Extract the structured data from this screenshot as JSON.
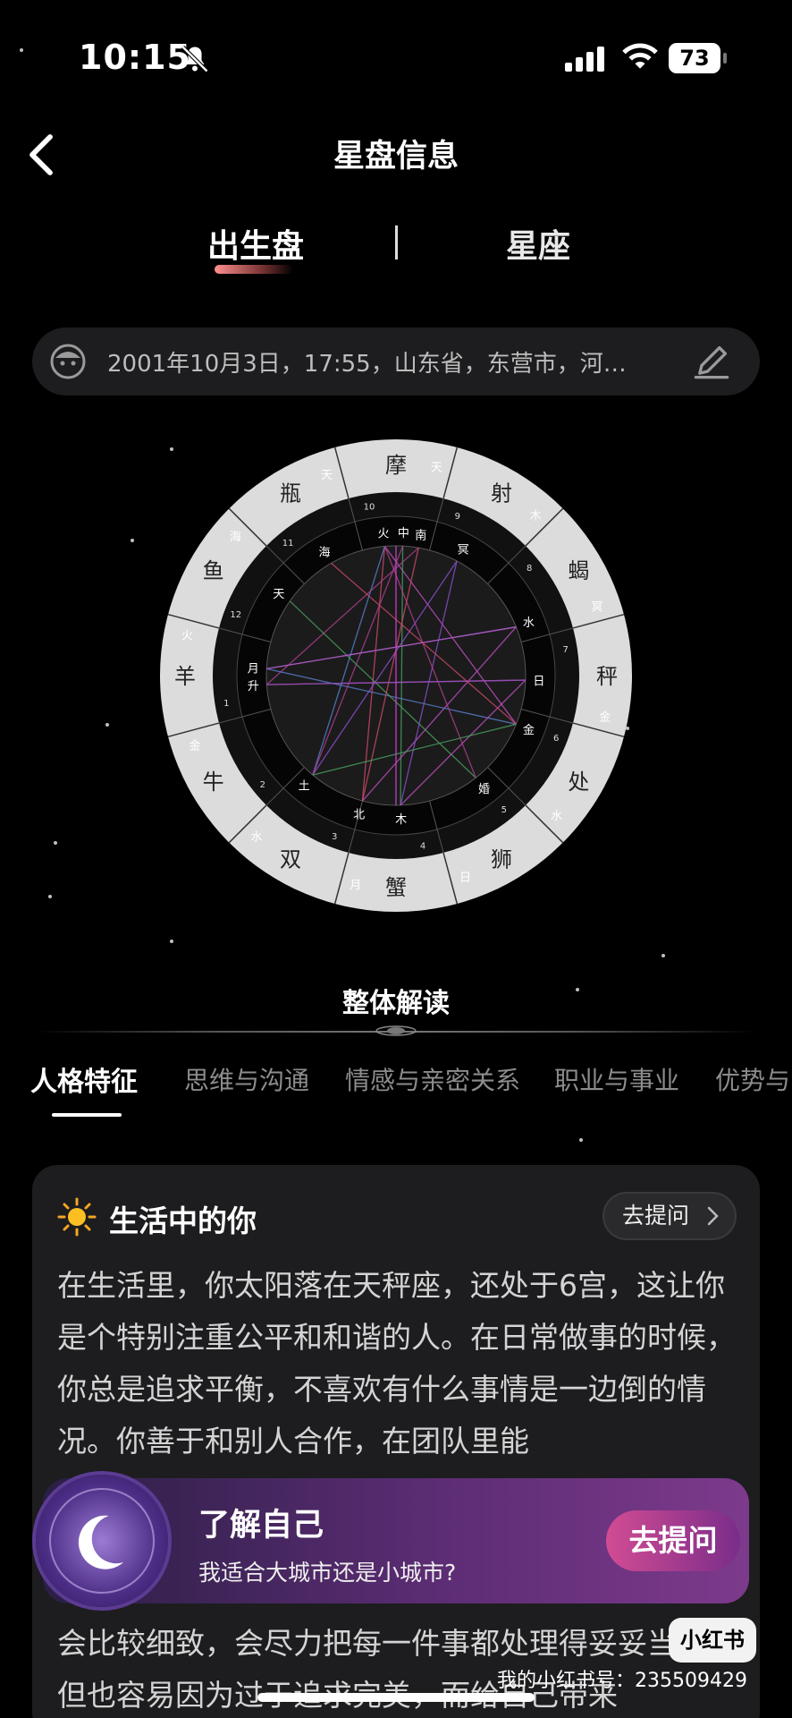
{
  "status_bar": {
    "time": "10:15",
    "battery": "73"
  },
  "header": {
    "title": "星盘信息"
  },
  "tabs": [
    {
      "label": "出生盘"
    },
    {
      "label": "星座"
    }
  ],
  "birth_info": {
    "text": "2001年10月3日，17:55，山东省，东营市，河…"
  },
  "chart": {
    "signs": [
      "摩",
      "射",
      "蝎",
      "秤",
      "处",
      "狮",
      "蟹",
      "双",
      "牛",
      "羊",
      "鱼",
      "瓶"
    ],
    "outer_planets": [
      "天",
      "木",
      "冥",
      "金",
      "水",
      "日",
      "月",
      "水",
      "金",
      "火",
      "海",
      "天"
    ],
    "houses": [
      "10",
      "9",
      "8",
      "7",
      "6",
      "5",
      "4",
      "3",
      "2",
      "1",
      "12",
      "11"
    ],
    "inner_labels": [
      "火",
      "中",
      "南",
      "冥",
      "水",
      "日",
      "金",
      "婚",
      "木",
      "北",
      "土",
      "升",
      "月",
      "天",
      "海"
    ]
  },
  "section_title": "整体解读",
  "reading_tabs": [
    "人格特征",
    "思维与沟通",
    "情感与亲密关系",
    "职业与事业",
    "优势与"
  ],
  "card": {
    "title": "生活中的你",
    "ask_label": "去提问",
    "paragraph": "在生活里，你太阳落在天秤座，还处于6宫，这让你是个特别注重公平和和谐的人。在日常做事的时候，你总是追求平衡，不喜欢有什么事情是一边倒的情况。你善于和别人合作，在团队里能"
  },
  "promo": {
    "title": "了解自己",
    "subtitle": "我适合大城市还是小城市?",
    "button": "去提问"
  },
  "bottom_paragraph": "会比较细致，会尽力把每一件事都处理得妥妥当当，但也容易因为过于追求完美，而给自己带来",
  "watermark": {
    "logo": "小红书",
    "id": "我的小红书号：235509429"
  },
  "colors": {
    "accent": "#d24c93",
    "card_bg": "#1d1d1f",
    "tab_underline": "#ff8f8f"
  }
}
